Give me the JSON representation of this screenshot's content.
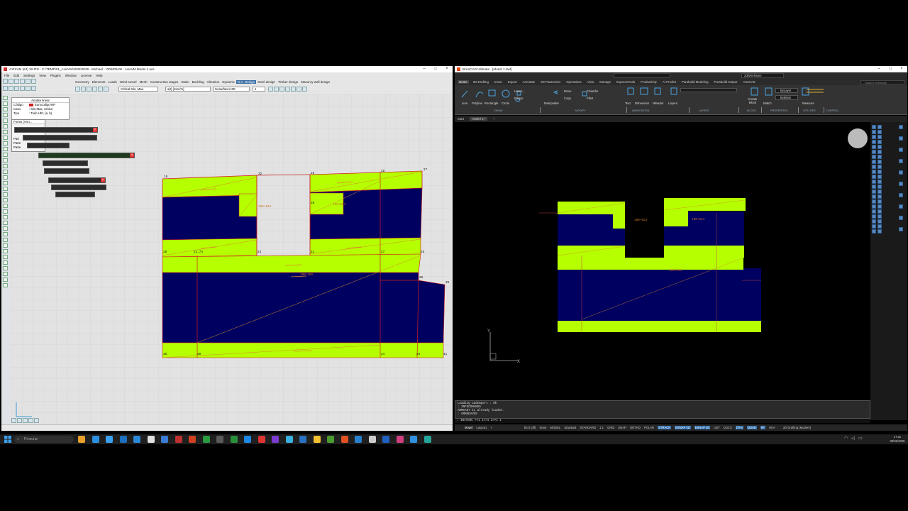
{
  "colors": {
    "panel_fill": "#b5ff00",
    "slab_fill": "#000060",
    "edge_red": "#d02020",
    "axm_bg": "#e6e6e6",
    "bricscad_bg": "#000000",
    "ribbon_bg": "#2b2b2b",
    "taskbar_bg": "#1f1f1f"
  },
  "axisvm": {
    "title": "AXISVM (64) X8 R3i - C:\\TEMP\\01_AxisVM\\2025\\0039 - Michael - OD5R0L00 - AxisVM Model 1.axs",
    "menu": [
      "File",
      "Edit",
      "Settings",
      "View",
      "Plugins",
      "Window",
      "License",
      "Help"
    ],
    "tabs": [
      "Geometry",
      "Elements",
      "Loads",
      "Wind tunnel",
      "Mesh",
      "Construction stages",
      "Static",
      "Buckling",
      "Vibration",
      "Dynamic",
      "R.C. Design",
      "Steel design",
      "Timber design",
      "Masonry wall design"
    ],
    "active_tab": "R.C. Design",
    "dropdown_combo": "Critical Min, Max.",
    "dropdown_component": "a(t) [mm²/m]",
    "dropdown_display": "Isosurfaces 2D",
    "dropdown_value": "1",
    "info_panel": {
      "title": "Analise linear",
      "rows": [
        {
          "k": "Código",
          "v": "Eurocodigo-NP"
        },
        {
          "k": "Caso",
          "v": ": Min,Max, Critico"
        },
        {
          "k": "Tipo",
          "v": ": Todo UEL (a, b)"
        }
      ]
    },
    "floating_title": "Forms (Arm...",
    "float_rows": [
      "Part",
      "Parte",
      "Parte"
    ],
    "node_labels": [
      {
        "t": "18"
      },
      {
        "t": "32"
      },
      {
        "t": "29"
      },
      {
        "t": "28"
      },
      {
        "t": "27"
      },
      {
        "t": "20"
      },
      {
        "t": "21.73"
      },
      {
        "t": "24"
      },
      {
        "t": "21"
      },
      {
        "t": "27"
      },
      {
        "t": "25"
      },
      {
        "t": "38"
      },
      {
        "t": "40"
      },
      {
        "t": "39"
      },
      {
        "t": "35"
      },
      {
        "t": "20"
      },
      {
        "t": "24"
      },
      {
        "t": "26"
      },
      {
        "t": "41"
      },
      {
        "t": "30"
      }
    ],
    "dim_labels": [
      "150+524",
      "150+524",
      "200+380"
    ],
    "status_coord": ""
  },
  "bricscad": {
    "title": "BricsCAD Ultimate - [Model 1.dwf]",
    "ribbon_tabs": [
      "Home",
      "2D Drafting",
      "Insert",
      "Export",
      "Annotate",
      "2D Parametric",
      "Operations",
      "View",
      "Manage",
      "ExpressTools",
      "Productivity",
      "AI Predict",
      "Parabuild Modeling",
      "Parabuild Output",
      "ArmCAD"
    ],
    "active_ribbon_tab": "Home",
    "ribbon_tools": [
      "Line",
      "Polyline",
      "Rectangle",
      "Circle",
      "Hatch...",
      "Ellipse",
      "Move",
      "Copy",
      "Manipulate",
      "Chamfer",
      "Fillet",
      "Text",
      "Dimension",
      "Mleader",
      "Layers",
      "Create Block",
      "Match",
      "Measure"
    ],
    "ribbon_sections": [
      "DRAW",
      "MODIFY",
      "ANNOTATION",
      "LAYERS",
      "BLOCK",
      "PROPERTIES",
      "UTILITIES",
      "CONTROL"
    ],
    "bylayer": "ByLayer",
    "byblock": "ByBlock",
    "visual_style": "2dWireframe",
    "search_placeholder": "Search in Bricsys",
    "doc_tabs": [
      "Start",
      "Model 1*",
      "+"
    ],
    "command_lines": [
      "Loading CadImport : Ok",
      ": INFOCOMANDO",
      "ARMCAD7 is already loaded.",
      ": ARMHEAVE9"
    ],
    "command_prompt": ": INITDOC  >>1 1>>1 1>>1 1",
    "status_left": [
      "Model",
      "Layout1",
      "+"
    ],
    "status_items": [
      "50.0 (off)",
      "None",
      "MODEL",
      "Standard",
      "STANDARD",
      "1:1",
      "GRID",
      "SNAP",
      "ORTHO",
      "POLAR",
      "STRACK",
      "ESNAP 2D",
      "ESNAP 3D",
      "LWT",
      "DUCS",
      "DYN",
      "QUAD",
      "RT",
      "HKA"
    ],
    "workspace": "2D Drafting (Modern)",
    "dim_labels": [
      "150+524",
      "150+524",
      "200+253"
    ]
  },
  "taskbar": {
    "search_placeholder": "Procurar",
    "time": "17:11",
    "date": "30/01/2025"
  }
}
